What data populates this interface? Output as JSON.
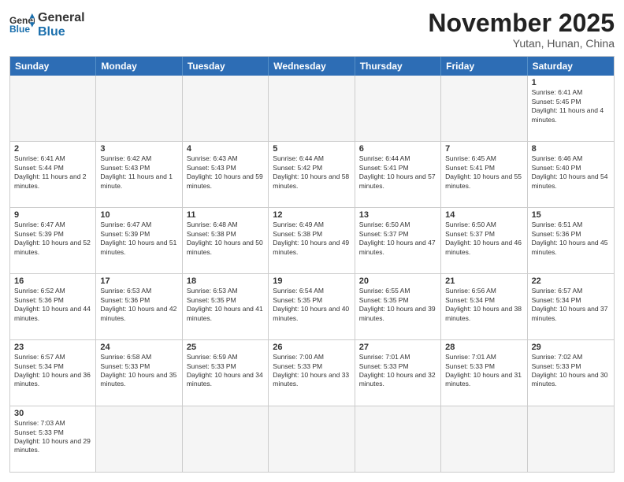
{
  "header": {
    "logo_general": "General",
    "logo_blue": "Blue",
    "month_title": "November 2025",
    "location": "Yutan, Hunan, China"
  },
  "weekdays": [
    "Sunday",
    "Monday",
    "Tuesday",
    "Wednesday",
    "Thursday",
    "Friday",
    "Saturday"
  ],
  "rows": [
    [
      {
        "day": "",
        "text": ""
      },
      {
        "day": "",
        "text": ""
      },
      {
        "day": "",
        "text": ""
      },
      {
        "day": "",
        "text": ""
      },
      {
        "day": "",
        "text": ""
      },
      {
        "day": "",
        "text": ""
      },
      {
        "day": "1",
        "text": "Sunrise: 6:41 AM\nSunset: 5:45 PM\nDaylight: 11 hours and 4 minutes."
      }
    ],
    [
      {
        "day": "2",
        "text": "Sunrise: 6:41 AM\nSunset: 5:44 PM\nDaylight: 11 hours and 2 minutes."
      },
      {
        "day": "3",
        "text": "Sunrise: 6:42 AM\nSunset: 5:43 PM\nDaylight: 11 hours and 1 minute."
      },
      {
        "day": "4",
        "text": "Sunrise: 6:43 AM\nSunset: 5:43 PM\nDaylight: 10 hours and 59 minutes."
      },
      {
        "day": "5",
        "text": "Sunrise: 6:44 AM\nSunset: 5:42 PM\nDaylight: 10 hours and 58 minutes."
      },
      {
        "day": "6",
        "text": "Sunrise: 6:44 AM\nSunset: 5:41 PM\nDaylight: 10 hours and 57 minutes."
      },
      {
        "day": "7",
        "text": "Sunrise: 6:45 AM\nSunset: 5:41 PM\nDaylight: 10 hours and 55 minutes."
      },
      {
        "day": "8",
        "text": "Sunrise: 6:46 AM\nSunset: 5:40 PM\nDaylight: 10 hours and 54 minutes."
      }
    ],
    [
      {
        "day": "9",
        "text": "Sunrise: 6:47 AM\nSunset: 5:39 PM\nDaylight: 10 hours and 52 minutes."
      },
      {
        "day": "10",
        "text": "Sunrise: 6:47 AM\nSunset: 5:39 PM\nDaylight: 10 hours and 51 minutes."
      },
      {
        "day": "11",
        "text": "Sunrise: 6:48 AM\nSunset: 5:38 PM\nDaylight: 10 hours and 50 minutes."
      },
      {
        "day": "12",
        "text": "Sunrise: 6:49 AM\nSunset: 5:38 PM\nDaylight: 10 hours and 49 minutes."
      },
      {
        "day": "13",
        "text": "Sunrise: 6:50 AM\nSunset: 5:37 PM\nDaylight: 10 hours and 47 minutes."
      },
      {
        "day": "14",
        "text": "Sunrise: 6:50 AM\nSunset: 5:37 PM\nDaylight: 10 hours and 46 minutes."
      },
      {
        "day": "15",
        "text": "Sunrise: 6:51 AM\nSunset: 5:36 PM\nDaylight: 10 hours and 45 minutes."
      }
    ],
    [
      {
        "day": "16",
        "text": "Sunrise: 6:52 AM\nSunset: 5:36 PM\nDaylight: 10 hours and 44 minutes."
      },
      {
        "day": "17",
        "text": "Sunrise: 6:53 AM\nSunset: 5:36 PM\nDaylight: 10 hours and 42 minutes."
      },
      {
        "day": "18",
        "text": "Sunrise: 6:53 AM\nSunset: 5:35 PM\nDaylight: 10 hours and 41 minutes."
      },
      {
        "day": "19",
        "text": "Sunrise: 6:54 AM\nSunset: 5:35 PM\nDaylight: 10 hours and 40 minutes."
      },
      {
        "day": "20",
        "text": "Sunrise: 6:55 AM\nSunset: 5:35 PM\nDaylight: 10 hours and 39 minutes."
      },
      {
        "day": "21",
        "text": "Sunrise: 6:56 AM\nSunset: 5:34 PM\nDaylight: 10 hours and 38 minutes."
      },
      {
        "day": "22",
        "text": "Sunrise: 6:57 AM\nSunset: 5:34 PM\nDaylight: 10 hours and 37 minutes."
      }
    ],
    [
      {
        "day": "23",
        "text": "Sunrise: 6:57 AM\nSunset: 5:34 PM\nDaylight: 10 hours and 36 minutes."
      },
      {
        "day": "24",
        "text": "Sunrise: 6:58 AM\nSunset: 5:33 PM\nDaylight: 10 hours and 35 minutes."
      },
      {
        "day": "25",
        "text": "Sunrise: 6:59 AM\nSunset: 5:33 PM\nDaylight: 10 hours and 34 minutes."
      },
      {
        "day": "26",
        "text": "Sunrise: 7:00 AM\nSunset: 5:33 PM\nDaylight: 10 hours and 33 minutes."
      },
      {
        "day": "27",
        "text": "Sunrise: 7:01 AM\nSunset: 5:33 PM\nDaylight: 10 hours and 32 minutes."
      },
      {
        "day": "28",
        "text": "Sunrise: 7:01 AM\nSunset: 5:33 PM\nDaylight: 10 hours and 31 minutes."
      },
      {
        "day": "29",
        "text": "Sunrise: 7:02 AM\nSunset: 5:33 PM\nDaylight: 10 hours and 30 minutes."
      }
    ],
    [
      {
        "day": "30",
        "text": "Sunrise: 7:03 AM\nSunset: 5:33 PM\nDaylight: 10 hours and 29 minutes."
      },
      {
        "day": "",
        "text": ""
      },
      {
        "day": "",
        "text": ""
      },
      {
        "day": "",
        "text": ""
      },
      {
        "day": "",
        "text": ""
      },
      {
        "day": "",
        "text": ""
      },
      {
        "day": "",
        "text": ""
      }
    ]
  ]
}
